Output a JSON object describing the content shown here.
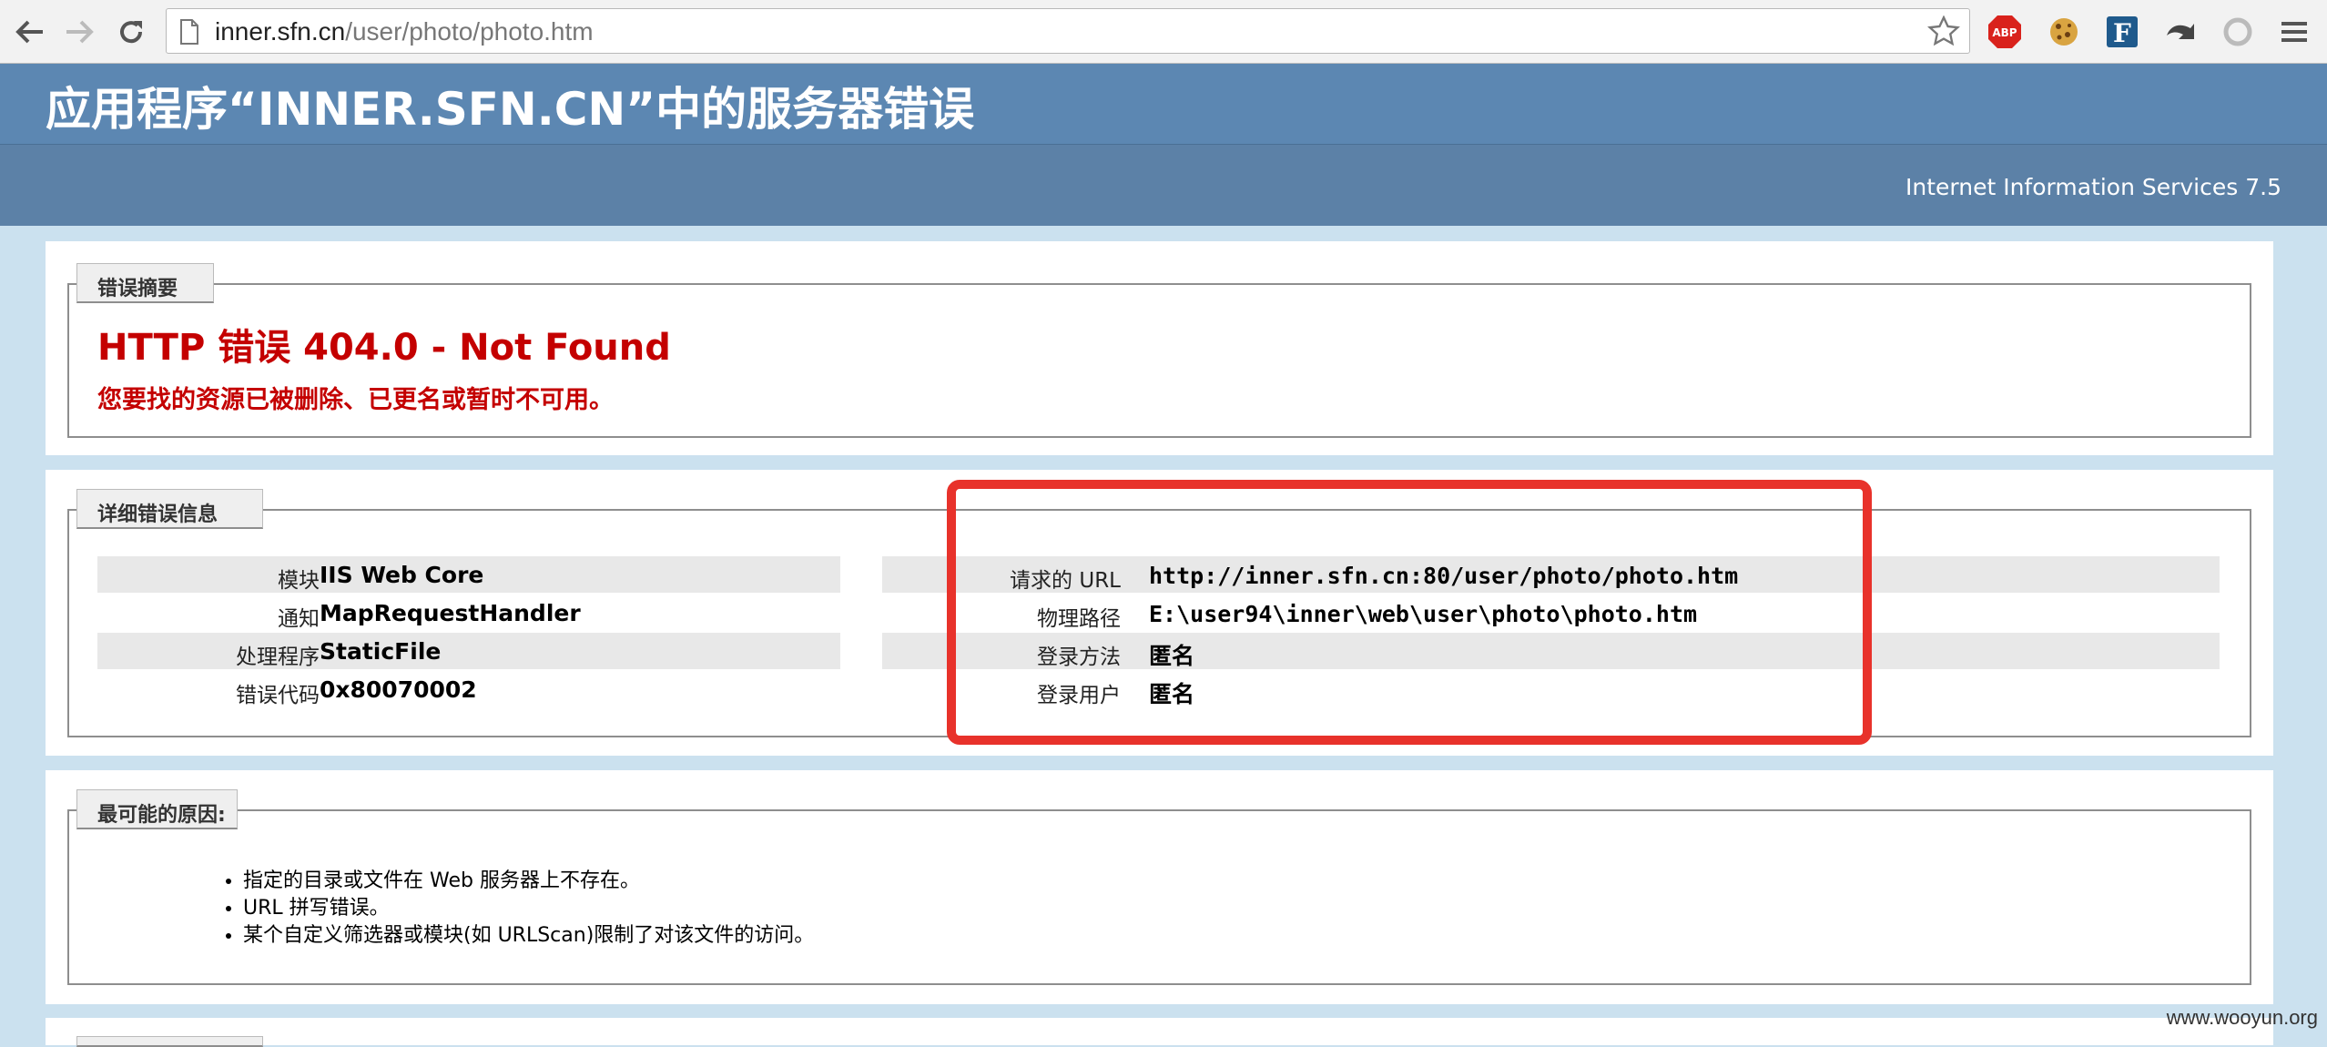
{
  "browser": {
    "url_host": "inner.sfn.cn",
    "url_path": "/user/photo/photo.htm",
    "extensions": [
      {
        "name": "adblock-icon",
        "text": "ABP"
      },
      {
        "name": "cookie-icon",
        "text": ""
      },
      {
        "name": "feedly-icon",
        "text": "F"
      },
      {
        "name": "undo-icon",
        "text": ""
      },
      {
        "name": "circle-icon",
        "text": ""
      }
    ]
  },
  "header": {
    "title": "应用程序“INNER.SFN.CN”中的服务器错误",
    "product": "Internet Information Services 7.5"
  },
  "summary": {
    "legend": "错误摘要",
    "title": "HTTP 错误 404.0 - Not Found",
    "message": "您要找的资源已被删除、已更名或暂时不可用。"
  },
  "details": {
    "legend": "详细错误信息",
    "left": [
      {
        "label": "模块",
        "value": "IIS Web Core"
      },
      {
        "label": "通知",
        "value": "MapRequestHandler"
      },
      {
        "label": "处理程序",
        "value": "StaticFile"
      },
      {
        "label": "错误代码",
        "value": "0x80070002"
      }
    ],
    "right": [
      {
        "label": "请求的 URL",
        "value": "http://inner.sfn.cn:80/user/photo/photo.htm"
      },
      {
        "label": "物理路径",
        "value": "E:\\user94\\inner\\web\\user\\photo\\photo.htm"
      },
      {
        "label": "登录方法",
        "value": "匿名"
      },
      {
        "label": "登录用户",
        "value": "匿名"
      }
    ]
  },
  "causes": {
    "legend": "最可能的原因:",
    "items": [
      "指定的目录或文件在 Web 服务器上不存在。",
      "URL 拼写错误。",
      "某个自定义筛选器或模块(如 URLScan)限制了对该文件的访问。"
    ]
  },
  "watermark": "www.wooyun.org",
  "colors": {
    "header_blue": "#5c87b2",
    "error_red": "#c40000",
    "annotation_red": "#e8322b",
    "page_bg": "#cbe1ef"
  }
}
